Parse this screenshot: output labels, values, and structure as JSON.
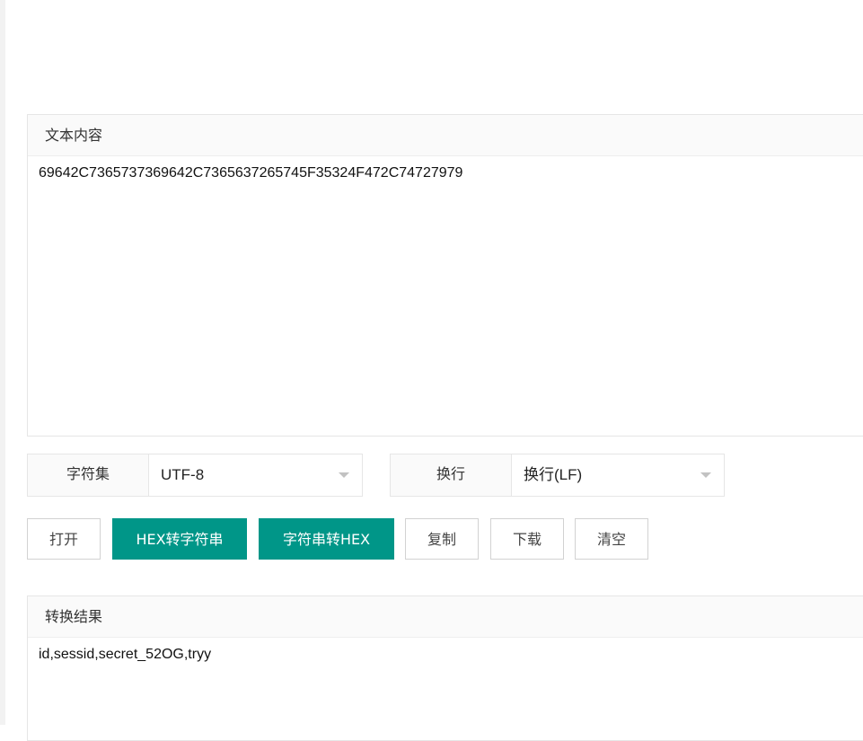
{
  "input_panel": {
    "header": "文本内容",
    "content": "69642C7365737369642C7365637265745F35324F472C74727979"
  },
  "charset": {
    "label": "字符集",
    "value": "UTF-8"
  },
  "newline": {
    "label": "换行",
    "value": "换行(LF)"
  },
  "buttons": {
    "open": "打开",
    "hex_to_string": "HEX转字符串",
    "string_to_hex": "字符串转HEX",
    "copy": "复制",
    "download": "下载",
    "clear": "清空"
  },
  "result_panel": {
    "header": "转换结果",
    "content": "id,sessid,secret_52OG,tryy"
  },
  "colors": {
    "primary": "#009688",
    "border": "#e6e6e6",
    "header_bg": "#fafafa"
  }
}
